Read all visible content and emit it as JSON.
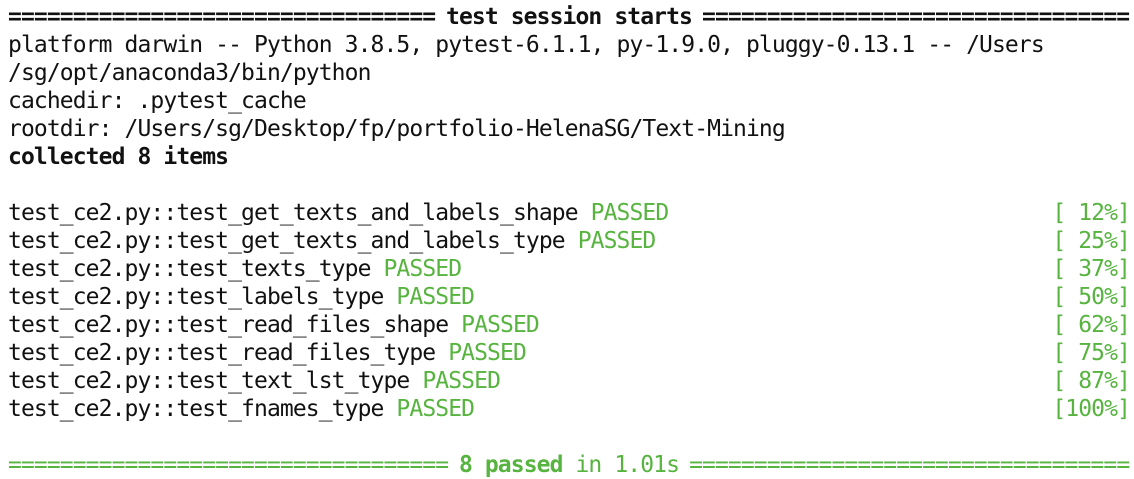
{
  "header": {
    "rule": "================================================================================",
    "title": "test session starts"
  },
  "info": {
    "platform_line": "platform darwin -- Python 3.8.5, pytest-6.1.1, py-1.9.0, pluggy-0.13.1 -- /Users",
    "python_path": "/sg/opt/anaconda3/bin/python",
    "cachedir": "cachedir: .pytest_cache",
    "rootdir": "rootdir: /Users/sg/Desktop/fp/portfolio-HelenaSG/Text-Mining",
    "collected": "collected 8 items"
  },
  "tests": [
    {
      "name": "test_ce2.py::test_get_texts_and_labels_shape",
      "status": "PASSED",
      "progress": "[ 12%]"
    },
    {
      "name": "test_ce2.py::test_get_texts_and_labels_type",
      "status": "PASSED",
      "progress": "[ 25%]"
    },
    {
      "name": "test_ce2.py::test_texts_type",
      "status": "PASSED",
      "progress": "[ 37%]"
    },
    {
      "name": "test_ce2.py::test_labels_type",
      "status": "PASSED",
      "progress": "[ 50%]"
    },
    {
      "name": "test_ce2.py::test_read_files_shape",
      "status": "PASSED",
      "progress": "[ 62%]"
    },
    {
      "name": "test_ce2.py::test_read_files_type",
      "status": "PASSED",
      "progress": "[ 75%]"
    },
    {
      "name": "test_ce2.py::test_text_lst_type",
      "status": "PASSED",
      "progress": "[ 87%]"
    },
    {
      "name": "test_ce2.py::test_fnames_type",
      "status": "PASSED",
      "progress": "[100%]"
    }
  ],
  "summary": {
    "rule": "================================================================================",
    "passed": "8 passed",
    "duration": "in 1.01s"
  },
  "colors": {
    "pass_green": "#56b43f",
    "text": "#111111",
    "background": "#ffffff"
  }
}
